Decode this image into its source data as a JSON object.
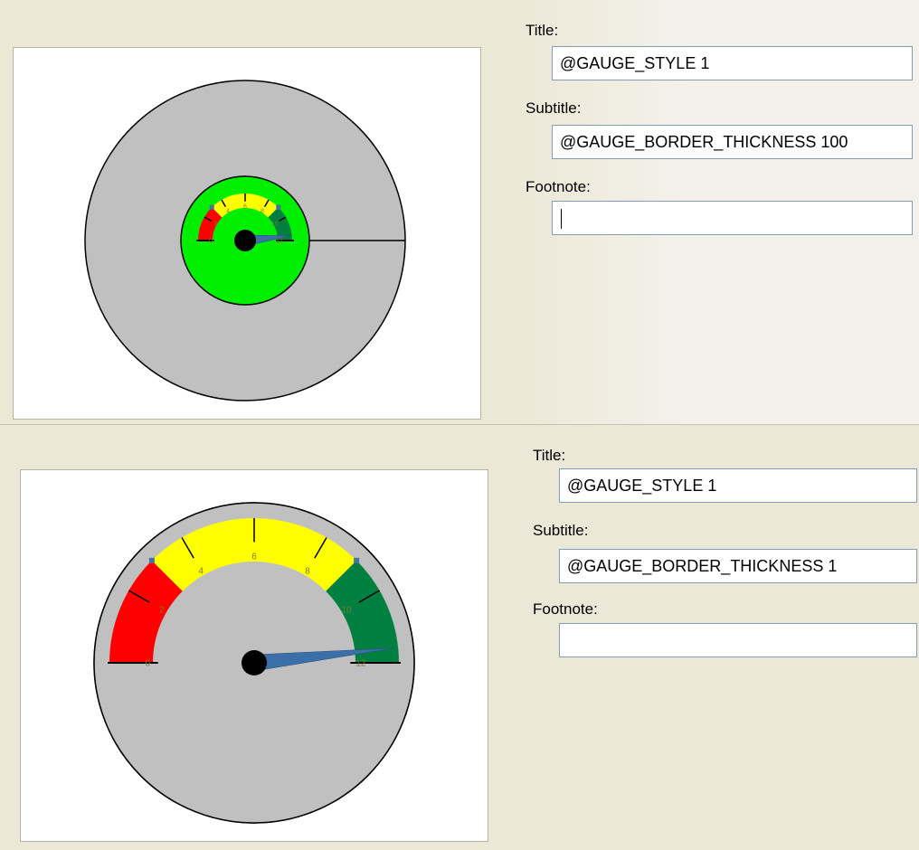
{
  "panels": [
    {
      "title_label": "Title:",
      "title_value": "@GAUGE_STYLE 1",
      "subtitle_label": "Subtitle:",
      "subtitle_value": "@GAUGE_BORDER_THICKNESS 100",
      "footnote_label": "Footnote:",
      "footnote_value": "",
      "footnote_focused": true
    },
    {
      "title_label": "Title:",
      "title_value": "@GAUGE_STYLE 1",
      "subtitle_label": "Subtitle:",
      "subtitle_value": "@GAUGE_BORDER_THICKNESS 1",
      "footnote_label": "Footnote:",
      "footnote_value": "",
      "footnote_focused": false
    }
  ],
  "gauges": [
    {
      "border_thickness": 100,
      "face_color": "#00ee00",
      "border_color": "#c0c0c0"
    },
    {
      "border_thickness": 1,
      "face_color": "#c0c0c0",
      "border_color": "#008000"
    }
  ],
  "chart_data": {
    "type": "gauge",
    "min": 0,
    "max": 12,
    "needle_value": 11.6,
    "major_tick_labels": [
      "0",
      "2",
      "4",
      "6",
      "8",
      "10",
      "12"
    ],
    "ranges": [
      {
        "from": 0,
        "to": 3,
        "color": "#ff0000"
      },
      {
        "from": 3,
        "to": 9,
        "color": "#ffff00"
      },
      {
        "from": 9,
        "to": 12,
        "color": "#008040"
      }
    ],
    "needle_color": "#3a6fa8",
    "hub_color": "#000000",
    "marker_color": "#4a6fa5"
  }
}
